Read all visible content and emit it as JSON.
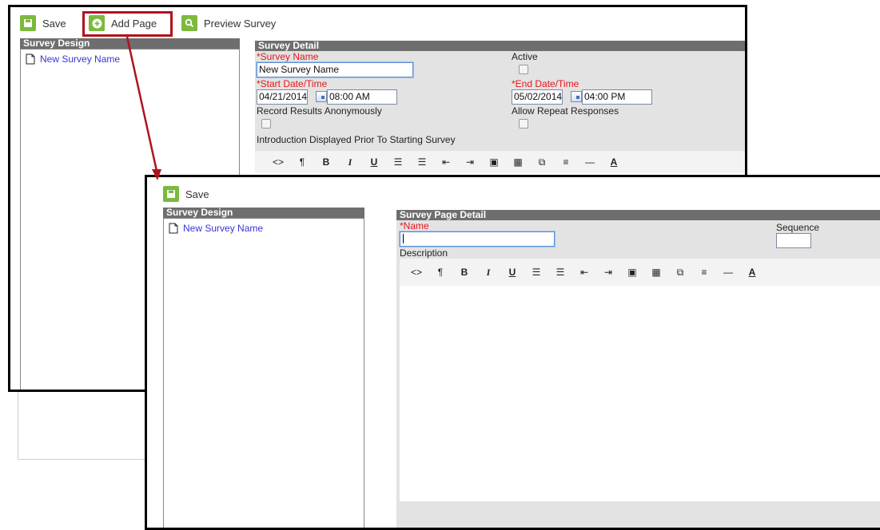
{
  "toolbar1": {
    "save_label": "Save",
    "add_page_label": "Add Page",
    "preview_label": "Preview Survey"
  },
  "design1": {
    "header": "Survey Design",
    "tree_item": "New Survey Name"
  },
  "survey_detail": {
    "header": "Survey Detail",
    "name_label": "*Survey Name",
    "name_value": "New Survey Name",
    "active_label": "Active",
    "start_label": "*Start Date/Time",
    "start_date": "04/21/2014",
    "start_time": "08:00 AM",
    "end_label": "*End Date/Time",
    "end_date": "05/02/2014",
    "end_time": "04:00 PM",
    "anon_label": "Record Results Anonymously",
    "repeat_label": "Allow Repeat Responses",
    "intro_label": "Introduction Displayed Prior To Starting Survey"
  },
  "editor_buttons": [
    "<>",
    "¶",
    "B",
    "I",
    "U",
    "☰",
    "☰",
    "⇤",
    "⇥",
    "▣",
    "▦",
    "⧉",
    "≡",
    "—",
    "A"
  ],
  "toolbar2": {
    "save_label": "Save"
  },
  "design2": {
    "header": "Survey Design",
    "tree_item": "New Survey Name"
  },
  "page_detail": {
    "header": "Survey Page Detail",
    "name_label": "*Name",
    "name_value": "",
    "sequence_label": "Sequence",
    "sequence_value": "",
    "description_label": "Description"
  },
  "colors": {
    "accent_green": "#7cb93c",
    "highlight_red": "#b0131b",
    "required_red": "#e8161b",
    "link_blue": "#3a33d6",
    "header_gray": "#6e6e6e",
    "panel_gray": "#e3e3e3"
  }
}
